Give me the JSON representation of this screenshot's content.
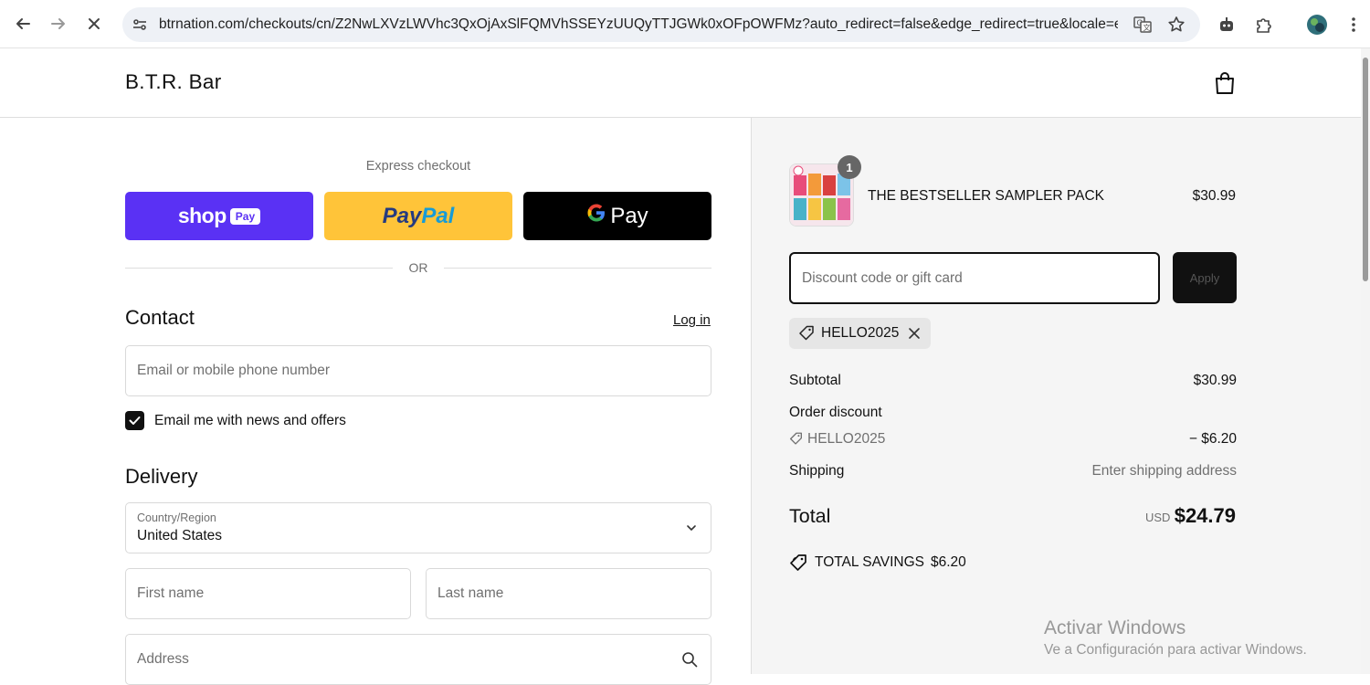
{
  "browser": {
    "url": "btrnation.com/checkouts/cn/Z2NwLXVzLWVhc3QxOjAxSlFQMVhSSEYzUUQyTTJGWk0xOFpOWFMz?auto_redirect=false&edge_redirect=true&locale=en-..."
  },
  "header": {
    "store_name": "B.T.R. Bar"
  },
  "express": {
    "title": "Express checkout",
    "shop_pay": {
      "shop": "shop",
      "pay": "Pay"
    },
    "paypal": {
      "part1": "Pay",
      "part2": "Pal"
    },
    "gpay": {
      "g": "G",
      "pay": "Pay"
    },
    "or": "OR"
  },
  "contact": {
    "title": "Contact",
    "login": "Log in",
    "email_placeholder": "Email or mobile phone number",
    "newsletter_label": "Email me with news and offers",
    "newsletter_checked": true
  },
  "delivery": {
    "title": "Delivery",
    "country_label": "Country/Region",
    "country_value": "United States",
    "first_name_placeholder": "First name",
    "last_name_placeholder": "Last name",
    "address_placeholder": "Address"
  },
  "order": {
    "product_name": "THE BESTSELLER SAMPLER PACK",
    "product_price": "$30.99",
    "quantity": "1",
    "discount_placeholder": "Discount code or gift card",
    "apply_label": "Apply",
    "applied_code": "HELLO2025",
    "subtotal_label": "Subtotal",
    "subtotal_value": "$30.99",
    "order_discount_label": "Order discount",
    "discount_code": "HELLO2025",
    "discount_value": "− $6.20",
    "shipping_label": "Shipping",
    "shipping_value": "Enter shipping address",
    "total_label": "Total",
    "total_currency": "USD",
    "total_value": "$24.79",
    "savings_label": "TOTAL SAVINGS",
    "savings_value": "$6.20"
  },
  "watermark": {
    "line1": "Activar Windows",
    "line2": "Ve a Configuración para activar Windows."
  },
  "colors": {
    "shop_pay": "#5a31f4",
    "paypal": "#ffc439",
    "gpay": "#000000",
    "summary_bg": "#f5f5f5"
  }
}
